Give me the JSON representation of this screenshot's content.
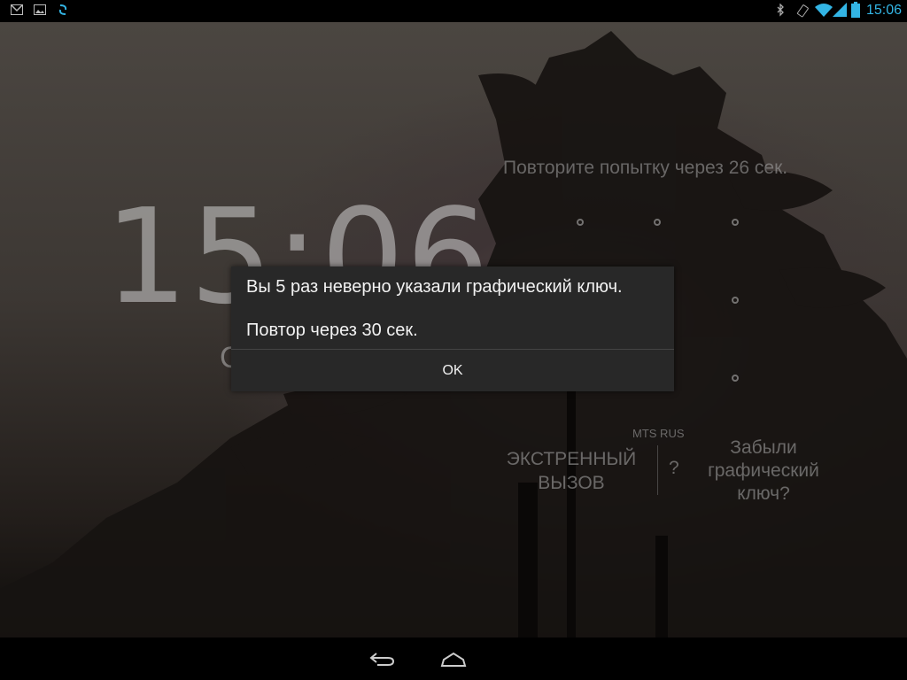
{
  "status_bar": {
    "time": "15:06",
    "notification_icons": [
      "gmail-icon",
      "gallery-icon",
      "sync-icon"
    ],
    "system_icons": [
      "bluetooth-icon",
      "rotation-lock-icon",
      "wifi-icon",
      "signal-icon",
      "battery-icon"
    ],
    "accent": "#33b5e5"
  },
  "lockscreen": {
    "clock": "15:06",
    "date_fragment": "С",
    "retry_message": "Повторите попытку через 26 сек.",
    "pattern_dots": 9,
    "carrier": "MTS RUS",
    "emergency_label": "ЭКСТРЕННЫЙ\nВЫЗОВ",
    "help_label": "?",
    "forgot_label": "Забыли\nграфический\nключ?"
  },
  "dialog": {
    "message": "Вы 5 раз неверно указали графический ключ.",
    "retry": "Повтор через 30 сек.",
    "ok_label": "OK"
  },
  "nav_bar": {
    "buttons": [
      "back-icon",
      "home-icon"
    ]
  }
}
